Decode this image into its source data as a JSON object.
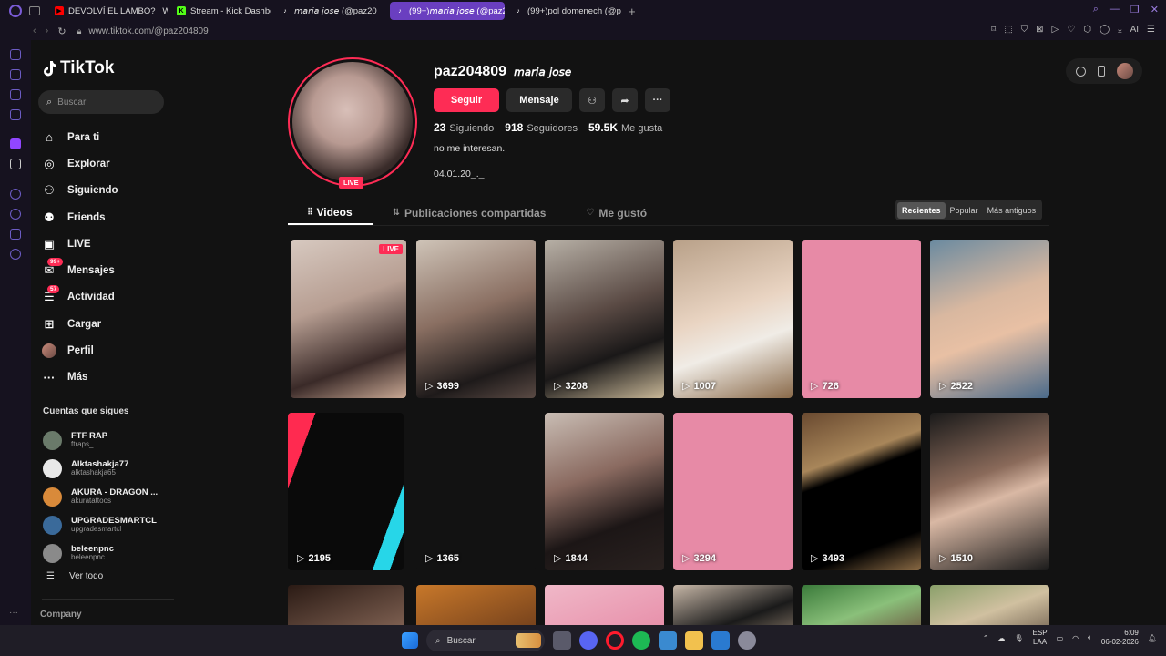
{
  "browser": {
    "tabs": [
      {
        "label": "DEVOLVÍ EL LAMBO? | WE",
        "fav_color": "#ff0000"
      },
      {
        "label": "Stream - Kick Dashboard",
        "fav_color": "#53fc18"
      },
      {
        "label": "𝘮𝘢𝘳𝘪𝘢 𝘫𝘰𝘴𝘦 (@paz20",
        "fav_color": "#ffffff"
      },
      {
        "label": "(99+)𝘮𝘢𝘳𝘪𝘢 𝘫𝘰𝘴𝘦 (@paz2",
        "fav_color": "#ffffff"
      },
      {
        "label": "(99+)pol domenech (@po",
        "fav_color": "#ffffff"
      }
    ],
    "new_tab_label": "+",
    "url": "www.tiktok.com/@paz204809",
    "ai_label": "AI"
  },
  "sidebar": {
    "logo_text": "TikTok",
    "search_placeholder": "Buscar",
    "nav": [
      {
        "label": "Para ti",
        "icon": "home-icon"
      },
      {
        "label": "Explorar",
        "icon": "compass-icon"
      },
      {
        "label": "Siguiendo",
        "icon": "user-follow-icon"
      },
      {
        "label": "Friends",
        "icon": "friends-icon"
      },
      {
        "label": "LIVE",
        "icon": "live-icon"
      },
      {
        "label": "Mensajes",
        "icon": "message-icon",
        "badge": "99+"
      },
      {
        "label": "Actividad",
        "icon": "activity-icon",
        "badge": "57"
      },
      {
        "label": "Cargar",
        "icon": "upload-icon"
      },
      {
        "label": "Perfil",
        "icon": "avatar"
      },
      {
        "label": "Más",
        "icon": "more-icon"
      }
    ],
    "following_title": "Cuentas que sigues",
    "following": [
      {
        "name": "FTF RAP",
        "handle": "ftraps_",
        "color": "#6a7a6a"
      },
      {
        "name": "Alktashakja77",
        "handle": "alktashakja65",
        "color": "#e8e8e8"
      },
      {
        "name": "AKURA - DRAGON ...",
        "handle": "akuratattoos",
        "color": "#d98a3a"
      },
      {
        "name": "UPGRADESMARTCL",
        "handle": "upgradesmartcl",
        "color": "#3a6a9a"
      },
      {
        "name": "beleenpnc",
        "handle": "beleenpnc",
        "color": "#8a8a8a"
      }
    ],
    "see_all": "Ver todo",
    "company": "Company"
  },
  "profile": {
    "username": "paz204809",
    "nickname": "𝘮𝘢𝘳𝘪𝘢 𝘫𝘰𝘴𝘦",
    "live_tag": "LIVE",
    "follow_label": "Seguir",
    "message_label": "Mensaje",
    "following_count": "23",
    "following_label": "Siguiendo",
    "followers_count": "918",
    "followers_label": "Seguidores",
    "likes_count": "59.5K",
    "likes_label": "Me gusta",
    "bio": "no me interesan.",
    "bio2": "04.01.20_._"
  },
  "tabs": {
    "videos": "Videos",
    "reposts": "Publicaciones compartidas",
    "liked": "Me gustó"
  },
  "sort": {
    "recent": "Recientes",
    "popular": "Popular",
    "oldest": "Más antiguos"
  },
  "videos": [
    {
      "views": "",
      "live": "LIVE",
      "bg": "linear-gradient(160deg,#d7c9c0 0%,#b79e92 40%,#3a2a28 75%,#c9a894 100%)"
    },
    {
      "views": "3699",
      "bg": "linear-gradient(160deg,#cfc4b8 0%,#8a6f62 45%,#1e1a1a 80%,#5a4a44 100%)"
    },
    {
      "views": "3208",
      "bg": "linear-gradient(160deg,#b7b0a6 0%,#5a4a44 45%,#1a1818 70%,#c9b898 100%)"
    },
    {
      "views": "1007",
      "bg": "linear-gradient(160deg,#b8a088 0%,#e9d4c2 45%,#f0ece6 65%,#8a6a4a 100%)"
    },
    {
      "views": "726",
      "bg": "#e78aa6"
    },
    {
      "views": "2522",
      "bg": "linear-gradient(160deg,#6a8aa0 0%,#d9b8a0 40%,#e8c0a4 60%,#4a6a8a 100%)"
    },
    {
      "views": "2195",
      "bg": "linear-gradient(110deg,#ff2a50 0%,#ff2a50 16%,#0a0a0a 16%,#0a0a0a 82%,#27d6e8 82%,#27d6e8 92%,#0a0a0a 92%)"
    },
    {
      "views": "1365",
      "bg": "#121212"
    },
    {
      "views": "1844",
      "bg": "linear-gradient(160deg,#c9bdb4 0%,#8a6a60 40%,#1c1616 70%,#2a2220 100%)"
    },
    {
      "views": "3294",
      "bg": "#e78aa6"
    },
    {
      "views": "3493",
      "bg": "linear-gradient(160deg,#6a4a30 0%,#a8865a 30%,#000000 40%,#000000 80%,#8a6a44 100%)"
    },
    {
      "views": "1510",
      "bg": "linear-gradient(160deg,#1a1a1a 0%,#8a6a5a 40%,#d9b8a4 55%,#1a1a1a 100%)"
    },
    {
      "views": "",
      "bg": "linear-gradient(160deg,#2a1a14 0%,#8a6a5a 100%)"
    },
    {
      "views": "",
      "bg": "linear-gradient(160deg,#c8782a 0%,#6a3a1a 100%)"
    },
    {
      "views": "",
      "bg": "linear-gradient(160deg,#f0b8c8 0%,#e68aa6 100%)"
    },
    {
      "views": "",
      "bg": "linear-gradient(160deg,#c8b8a8 0%,#1a1a1a 60%,#8a7a6a 100%)"
    },
    {
      "views": "",
      "bg": "linear-gradient(160deg,#3a7a3a 0%,#8ac07a 50%,#6a4a3a 100%)"
    },
    {
      "views": "",
      "bg": "linear-gradient(160deg,#8aa06a 0%,#d0c0a0 50%,#6a5a4a 100%)"
    }
  ],
  "taskbar": {
    "search_label": "Buscar",
    "lang": "ESP",
    "layout": "LAA",
    "time": "6:09",
    "date": "06-02-2026"
  }
}
